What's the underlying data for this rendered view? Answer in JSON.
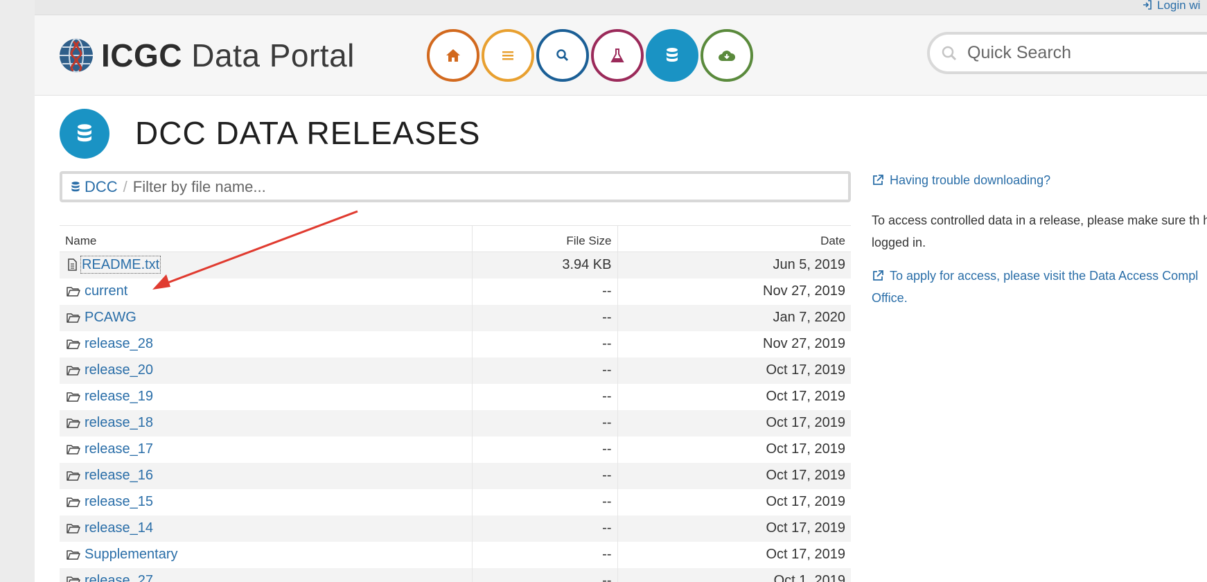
{
  "login": {
    "label": "Login wi"
  },
  "header": {
    "logo_bold": "ICGC",
    "logo_rest": "Data Portal",
    "nav": [
      {
        "name": "home-nav-button",
        "icon": "home-icon",
        "color": "#d2691e"
      },
      {
        "name": "menu-nav-button",
        "icon": "list-icon",
        "color": "#e8a030"
      },
      {
        "name": "search-nav-button",
        "icon": "search-icon",
        "color": "#1b5f96"
      },
      {
        "name": "analysis-nav-button",
        "icon": "flask-icon",
        "color": "#9b2a5a"
      },
      {
        "name": "data-releases-nav-button",
        "icon": "database-icon",
        "color": "#1a93c4"
      },
      {
        "name": "download-nav-button",
        "icon": "cloud-download-icon",
        "color": "#5a8a3c"
      }
    ],
    "search_placeholder": "Quick Search"
  },
  "page": {
    "title": "DCC DATA RELEASES"
  },
  "filter": {
    "crumb": "DCC",
    "separator": "/",
    "placeholder": "Filter by file name..."
  },
  "table": {
    "headers": {
      "name": "Name",
      "size": "File Size",
      "date": "Date"
    },
    "rows": [
      {
        "type": "file",
        "name": "README.txt",
        "size": "3.94 KB",
        "date": "Jun 5, 2019"
      },
      {
        "type": "folder",
        "name": "current",
        "size": "--",
        "date": "Nov 27, 2019"
      },
      {
        "type": "folder",
        "name": "PCAWG",
        "size": "--",
        "date": "Jan 7, 2020"
      },
      {
        "type": "folder",
        "name": "release_28",
        "size": "--",
        "date": "Nov 27, 2019"
      },
      {
        "type": "folder",
        "name": "release_20",
        "size": "--",
        "date": "Oct 17, 2019"
      },
      {
        "type": "folder",
        "name": "release_19",
        "size": "--",
        "date": "Oct 17, 2019"
      },
      {
        "type": "folder",
        "name": "release_18",
        "size": "--",
        "date": "Oct 17, 2019"
      },
      {
        "type": "folder",
        "name": "release_17",
        "size": "--",
        "date": "Oct 17, 2019"
      },
      {
        "type": "folder",
        "name": "release_16",
        "size": "--",
        "date": "Oct 17, 2019"
      },
      {
        "type": "folder",
        "name": "release_15",
        "size": "--",
        "date": "Oct 17, 2019"
      },
      {
        "type": "folder",
        "name": "release_14",
        "size": "--",
        "date": "Oct 17, 2019"
      },
      {
        "type": "folder",
        "name": "Supplementary",
        "size": "--",
        "date": "Oct 17, 2019"
      },
      {
        "type": "folder",
        "name": "release_27",
        "size": "--",
        "date": "Oct 1, 2019"
      }
    ]
  },
  "sidebar": {
    "trouble_link": "Having trouble downloading?",
    "access_text": "To access controlled data in a release, please make sure th have logged in.",
    "apply_link": "To apply for access, please visit the Data Access Compl Office."
  },
  "colors": {
    "link": "#2a6ea8",
    "accent": "#1a93c4",
    "annotation_arrow": "#e03b30"
  }
}
